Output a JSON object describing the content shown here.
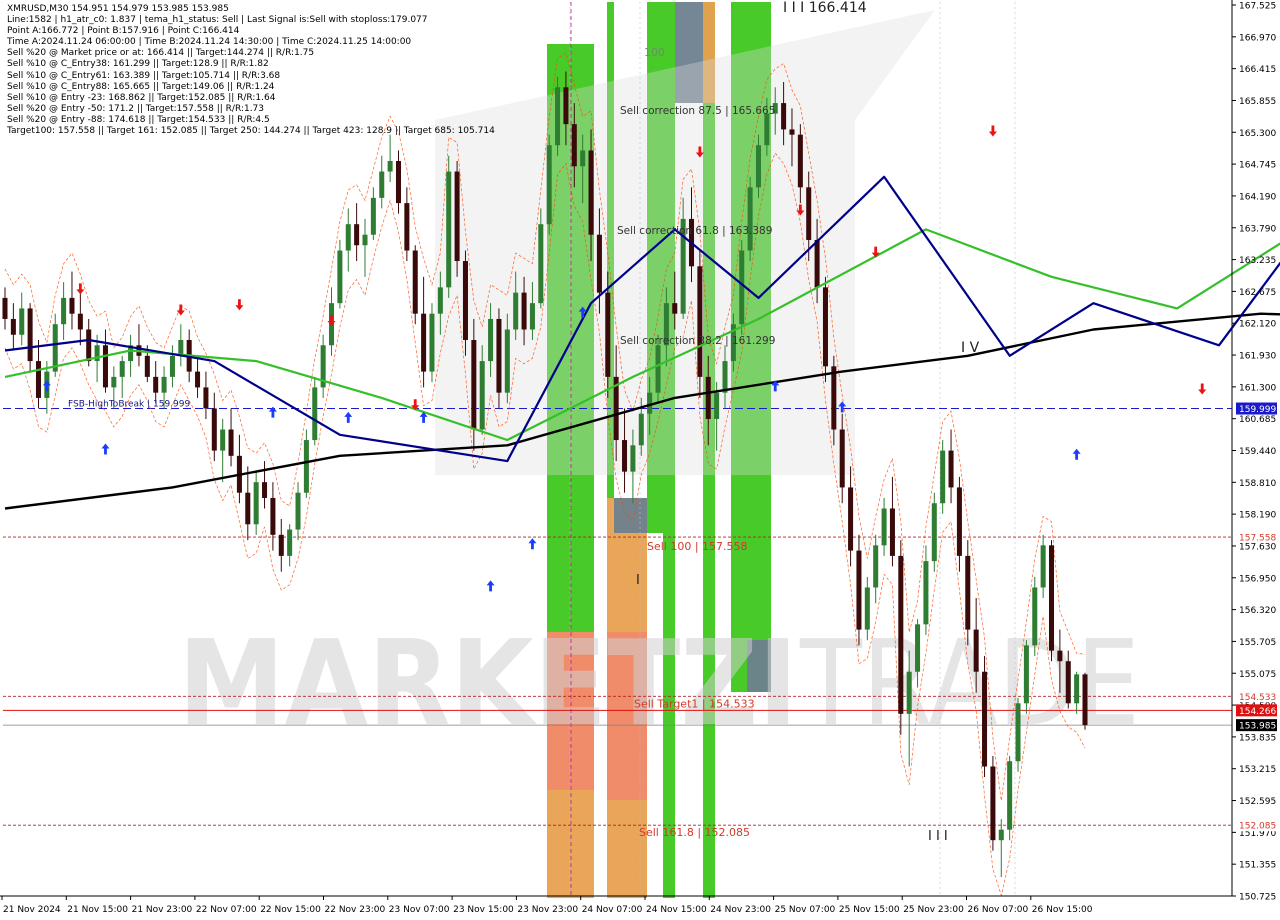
{
  "info": {
    "lines": [
      "XMRUSD,M30  154.951 154.979 153.985 153.985",
      "Line:1582 | h1_atr_c0: 1.837 | tema_h1_status: Sell | Last Signal is:Sell with stoploss:179.077",
      "Point A:166.772 | Point B:157.916 | Point C:166.414",
      "Time A:2024.11.24 06:00:00 | Time B:2024.11.24 14:30:00 | Time C:2024.11.25 14:00:00",
      "Sell %20 @ Market price or at: 166.414 || Target:144.274 || R/R:1.75",
      "Sell %10 @ C_Entry38: 161.299 || Target:128.9 || R/R:1.82",
      "Sell %10 @ C_Entry61: 163.389 || Target:105.714 || R/R:3.68",
      "Sell %10 @ C_Entry88: 165.665 || Target:149.06 || R/R:1.24",
      "Sell %10 @ Entry -23: 168.862 || Target:152.085 || R/R:1.64",
      "Sell %20 @ Entry -50: 171.2 || Target:157.558 || R/R:1.73",
      "Sell %20 @ Entry -88: 174.618 || Target:154.533 || R/R:4.5",
      "Target100: 157.558 || Target 161: 152.085 || Target 250: 144.274 || Target 423: 128.9 || Target 685: 105.714"
    ]
  },
  "watermark": {
    "text_left": "MARKETZI",
    "text_right": "TRADE"
  },
  "colors": {
    "green_zone": "#3ec81e",
    "orange_zone": "#e8a04f",
    "salmon_zone": "#f08a6c",
    "gray_zone": "#6e7f8f",
    "bull_candle": "#2e7d32",
    "bear_candle": "#3a0a0a",
    "ma_slow": "#000000",
    "ma_mid": "#35c02a",
    "ma_fast": "#00008b",
    "envelope": "#ff4500",
    "level_line": "#b22222",
    "blue_dash": "#1a1acd",
    "current_line": "#7f7f7f",
    "arrow_up": "#1a3cff",
    "arrow_down": "#ee1111",
    "trend_red": "#ff0000"
  },
  "chart_data": {
    "type": "candlestick",
    "symbol": "XMRUSD",
    "timeframe": "M30",
    "ylim": [
      150.74,
      167.72
    ],
    "y_ticks": [
      "167.525",
      "166.970",
      "166.415",
      "165.855",
      "165.300",
      "164.745",
      "164.190",
      "163.790",
      "163.235",
      "162.675",
      "162.120",
      "161.930",
      "161.300",
      "160.685",
      "159.440",
      "158.810",
      "158.190",
      "157.630",
      "156.950",
      "156.320",
      "155.705",
      "155.075",
      "154.500",
      "153.835",
      "153.215",
      "152.595",
      "151.970",
      "151.355",
      "150.725"
    ],
    "x_ticks": [
      "21 Nov 2024",
      "21 Nov 15:00",
      "21 Nov 23:00",
      "22 Nov 07:00",
      "22 Nov 15:00",
      "22 Nov 23:00",
      "23 Nov 07:00",
      "23 Nov 15:00",
      "23 Nov 23:00",
      "24 Nov 07:00",
      "24 Nov 15:00",
      "24 Nov 23:00",
      "25 Nov 07:00",
      "25 Nov 15:00",
      "25 Nov 23:00",
      "26 Nov 07:00",
      "26 Nov 15:00"
    ],
    "levels": [
      {
        "label": "Sell 100 | 157.558",
        "price": 157.558,
        "tag": "157.558"
      },
      {
        "label": "Sell Target1 | 154.533",
        "price": 154.533,
        "tag": "154.533"
      },
      {
        "label": "Sell 161.8 | 152.085",
        "price": 152.085,
        "tag": "152.085"
      }
    ],
    "stoploss_line": {
      "price": 154.266,
      "tag": "154.266"
    },
    "fsb_line": {
      "price": 159.999,
      "tag": "159.999",
      "label": "FSB-HighToBreak | 159.999"
    },
    "current_price": {
      "price": 153.985,
      "tag": "153.985"
    },
    "corrections": [
      {
        "label": "Sell correction 87.5 | 165.665",
        "price": 165.665
      },
      {
        "label": "Sell correction 61.8 | 163.389",
        "price": 163.389
      },
      {
        "label": "Sell correction 38.2 | 161.299",
        "price": 161.299
      }
    ],
    "text_marks": {
      "peak_label": "I I I 166.414",
      "wave_iv": "I V",
      "wave_iii": "I I I",
      "wave_i": "I",
      "hundred": "100"
    },
    "candles": [
      [
        162.1,
        162.3,
        161.5,
        161.7
      ],
      [
        161.7,
        162.0,
        161.1,
        161.4
      ],
      [
        161.4,
        162.2,
        161.2,
        161.9
      ],
      [
        161.9,
        162.0,
        160.7,
        160.9
      ],
      [
        160.9,
        161.3,
        160.0,
        160.2
      ],
      [
        160.2,
        160.9,
        159.9,
        160.7
      ],
      [
        160.7,
        161.8,
        160.6,
        161.6
      ],
      [
        161.6,
        162.4,
        161.3,
        162.1
      ],
      [
        162.1,
        162.6,
        161.5,
        161.8
      ],
      [
        161.8,
        162.2,
        161.2,
        161.5
      ],
      [
        161.5,
        161.7,
        160.8,
        160.9
      ],
      [
        160.9,
        161.4,
        160.5,
        161.2
      ],
      [
        161.2,
        161.5,
        160.3,
        160.4
      ],
      [
        160.4,
        160.8,
        160.0,
        160.6
      ],
      [
        160.6,
        161.0,
        160.2,
        160.9
      ],
      [
        160.9,
        161.4,
        160.6,
        161.2
      ],
      [
        161.2,
        161.6,
        160.8,
        161.0
      ],
      [
        161.0,
        161.2,
        160.5,
        160.6
      ],
      [
        160.6,
        160.9,
        160.1,
        160.3
      ],
      [
        160.3,
        160.8,
        160.0,
        160.6
      ],
      [
        160.6,
        161.2,
        160.4,
        161.0
      ],
      [
        161.0,
        161.6,
        160.8,
        161.3
      ],
      [
        161.3,
        161.5,
        160.5,
        160.7
      ],
      [
        160.7,
        161.0,
        160.2,
        160.4
      ],
      [
        160.4,
        160.7,
        159.8,
        160.0
      ],
      [
        160.0,
        160.3,
        159.0,
        159.2
      ],
      [
        159.2,
        159.8,
        158.6,
        159.6
      ],
      [
        159.6,
        160.0,
        158.9,
        159.1
      ],
      [
        159.1,
        159.5,
        158.2,
        158.4
      ],
      [
        158.4,
        158.9,
        157.5,
        157.8
      ],
      [
        157.8,
        158.8,
        157.6,
        158.6
      ],
      [
        158.6,
        159.0,
        158.1,
        158.3
      ],
      [
        158.3,
        158.6,
        157.3,
        157.6
      ],
      [
        157.6,
        157.9,
        156.9,
        157.2
      ],
      [
        157.2,
        157.8,
        157.0,
        157.7
      ],
      [
        157.7,
        158.6,
        157.5,
        158.4
      ],
      [
        158.4,
        159.6,
        158.3,
        159.4
      ],
      [
        159.4,
        160.6,
        159.3,
        160.4
      ],
      [
        160.4,
        161.4,
        160.2,
        161.2
      ],
      [
        161.2,
        162.3,
        161.0,
        162.0
      ],
      [
        162.0,
        163.2,
        161.9,
        163.0
      ],
      [
        163.0,
        163.8,
        162.6,
        163.5
      ],
      [
        163.5,
        163.9,
        162.8,
        163.1
      ],
      [
        163.1,
        163.6,
        162.5,
        163.3
      ],
      [
        163.3,
        164.2,
        163.2,
        164.0
      ],
      [
        164.0,
        164.8,
        163.8,
        164.5
      ],
      [
        164.5,
        165.2,
        164.3,
        164.7
      ],
      [
        164.7,
        164.9,
        163.7,
        163.9
      ],
      [
        163.9,
        164.2,
        162.8,
        163.0
      ],
      [
        163.0,
        163.1,
        161.6,
        161.8
      ],
      [
        161.8,
        162.5,
        160.4,
        160.7
      ],
      [
        160.7,
        162.0,
        160.5,
        161.8
      ],
      [
        161.8,
        162.6,
        161.4,
        162.3
      ],
      [
        162.3,
        164.8,
        162.1,
        164.5
      ],
      [
        164.5,
        164.7,
        162.5,
        162.8
      ],
      [
        162.8,
        163.0,
        161.0,
        161.3
      ],
      [
        161.3,
        161.7,
        159.2,
        159.6
      ],
      [
        159.6,
        161.2,
        159.5,
        160.9
      ],
      [
        160.9,
        162.0,
        160.6,
        161.7
      ],
      [
        161.7,
        161.9,
        160.0,
        160.3
      ],
      [
        160.3,
        161.8,
        160.1,
        161.5
      ],
      [
        161.5,
        162.6,
        161.3,
        162.2
      ],
      [
        162.2,
        162.5,
        161.2,
        161.5
      ],
      [
        161.5,
        162.4,
        161.3,
        162.0
      ],
      [
        162.0,
        163.8,
        161.9,
        163.5
      ],
      [
        163.5,
        165.2,
        163.3,
        165.0
      ],
      [
        165.0,
        166.3,
        164.8,
        166.1
      ],
      [
        166.1,
        166.4,
        165.0,
        165.4
      ],
      [
        165.4,
        165.8,
        164.2,
        164.6
      ],
      [
        164.6,
        165.2,
        163.9,
        164.9
      ],
      [
        164.9,
        165.3,
        162.8,
        163.3
      ],
      [
        163.3,
        163.8,
        161.8,
        162.2
      ],
      [
        162.2,
        162.6,
        160.2,
        160.6
      ],
      [
        160.6,
        161.2,
        159.0,
        159.4
      ],
      [
        159.4,
        160.0,
        158.4,
        158.8
      ],
      [
        158.8,
        159.6,
        158.2,
        159.3
      ],
      [
        159.3,
        160.2,
        159.1,
        159.9
      ],
      [
        159.9,
        160.6,
        159.5,
        160.3
      ],
      [
        160.3,
        161.4,
        160.1,
        161.2
      ],
      [
        161.2,
        162.3,
        160.8,
        162.0
      ],
      [
        162.0,
        162.6,
        161.5,
        161.8
      ],
      [
        161.8,
        164.0,
        161.7,
        163.6
      ],
      [
        163.6,
        164.2,
        162.4,
        162.7
      ],
      [
        162.7,
        163.0,
        160.2,
        160.6
      ],
      [
        160.6,
        161.0,
        159.3,
        159.8
      ],
      [
        159.8,
        160.5,
        159.2,
        160.3
      ],
      [
        160.3,
        161.2,
        160.0,
        160.9
      ],
      [
        160.9,
        161.8,
        160.7,
        161.6
      ],
      [
        161.6,
        163.2,
        161.4,
        163.0
      ],
      [
        163.0,
        164.4,
        162.8,
        164.2
      ],
      [
        164.2,
        165.2,
        164.0,
        165.0
      ],
      [
        165.0,
        165.9,
        164.8,
        165.6
      ],
      [
        165.6,
        166.1,
        165.2,
        165.8
      ],
      [
        165.8,
        166.2,
        165.0,
        165.3
      ],
      [
        165.3,
        165.7,
        164.6,
        165.2
      ],
      [
        165.2,
        165.4,
        163.9,
        164.2
      ],
      [
        164.2,
        164.5,
        162.8,
        163.2
      ],
      [
        163.2,
        163.6,
        162.0,
        162.3
      ],
      [
        162.3,
        162.5,
        160.5,
        160.8
      ],
      [
        160.8,
        161.0,
        159.3,
        159.6
      ],
      [
        159.6,
        159.9,
        158.2,
        158.5
      ],
      [
        158.5,
        158.9,
        157.0,
        157.3
      ],
      [
        157.3,
        157.6,
        155.5,
        155.8
      ],
      [
        155.8,
        156.8,
        155.6,
        156.6
      ],
      [
        156.6,
        157.6,
        156.3,
        157.4
      ],
      [
        157.4,
        158.3,
        157.2,
        158.1
      ],
      [
        158.1,
        158.7,
        157.0,
        157.2
      ],
      [
        157.2,
        157.5,
        153.8,
        154.2
      ],
      [
        154.2,
        155.4,
        153.2,
        155.0
      ],
      [
        155.0,
        156.0,
        154.7,
        155.9
      ],
      [
        155.9,
        157.4,
        155.7,
        157.1
      ],
      [
        157.1,
        158.4,
        156.9,
        158.2
      ],
      [
        158.2,
        159.4,
        158.0,
        159.2
      ],
      [
        159.2,
        159.6,
        158.2,
        158.5
      ],
      [
        158.5,
        158.7,
        156.9,
        157.2
      ],
      [
        157.2,
        157.5,
        155.5,
        155.8
      ],
      [
        155.8,
        156.4,
        154.6,
        155.0
      ],
      [
        155.0,
        155.3,
        153.0,
        153.2
      ],
      [
        153.2,
        153.4,
        151.6,
        151.8
      ],
      [
        151.8,
        152.2,
        151.1,
        152.0
      ],
      [
        152.0,
        153.4,
        151.8,
        153.3
      ],
      [
        153.3,
        154.5,
        153.1,
        154.4
      ],
      [
        154.4,
        155.6,
        154.2,
        155.5
      ],
      [
        155.5,
        156.8,
        155.3,
        156.6
      ],
      [
        156.6,
        157.6,
        156.4,
        157.4
      ],
      [
        157.4,
        157.5,
        155.2,
        155.4
      ],
      [
        155.4,
        155.8,
        154.6,
        155.2
      ],
      [
        155.2,
        155.4,
        154.3,
        154.4
      ],
      [
        154.4,
        155.0,
        154.2,
        154.95
      ],
      [
        154.95,
        154.98,
        153.9,
        153.985
      ]
    ],
    "ma_slow": [
      [
        0,
        158.1
      ],
      [
        20,
        158.5
      ],
      [
        40,
        159.1
      ],
      [
        60,
        159.3
      ],
      [
        80,
        160.2
      ],
      [
        100,
        160.7
      ],
      [
        115,
        161.0
      ],
      [
        130,
        161.5
      ],
      [
        150,
        161.8
      ],
      [
        170,
        161.7
      ],
      [
        190,
        160.2
      ],
      [
        205,
        159.5
      ]
    ],
    "ma_mid": [
      [
        0,
        160.6
      ],
      [
        15,
        161.1
      ],
      [
        30,
        160.9
      ],
      [
        45,
        160.2
      ],
      [
        60,
        159.4
      ],
      [
        75,
        160.6
      ],
      [
        90,
        161.7
      ],
      [
        110,
        163.4
      ],
      [
        125,
        162.5
      ],
      [
        140,
        161.9
      ],
      [
        155,
        163.4
      ],
      [
        170,
        162.5
      ],
      [
        185,
        160.3
      ],
      [
        205,
        156.7
      ]
    ],
    "ma_fast": [
      [
        0,
        161.1
      ],
      [
        10,
        161.3
      ],
      [
        25,
        160.9
      ],
      [
        40,
        159.5
      ],
      [
        60,
        159.0
      ],
      [
        70,
        162.0
      ],
      [
        80,
        163.4
      ],
      [
        90,
        162.1
      ],
      [
        105,
        164.4
      ],
      [
        120,
        161.0
      ],
      [
        130,
        162.0
      ],
      [
        145,
        161.2
      ],
      [
        160,
        164.4
      ],
      [
        170,
        163.2
      ],
      [
        180,
        160.0
      ],
      [
        190,
        158.2
      ],
      [
        200,
        155.0
      ],
      [
        205,
        154.6
      ]
    ],
    "trend_lines": [
      {
        "from": [
          195,
          151.1
        ],
        "to": [
          205,
          154.0
        ]
      },
      {
        "from": [
          195,
          154.5
        ],
        "to": [
          202,
          157.8
        ]
      }
    ],
    "arrows_up": [
      [
        5,
        160.8
      ],
      [
        12,
        159.6
      ],
      [
        32,
        160.3
      ],
      [
        41,
        160.2
      ],
      [
        50,
        160.2
      ],
      [
        58,
        157.0
      ],
      [
        63,
        157.8
      ],
      [
        69,
        162.2
      ],
      [
        92,
        160.8
      ],
      [
        100,
        160.4
      ],
      [
        128,
        159.5
      ],
      [
        154,
        160.9
      ],
      [
        188,
        155.3
      ],
      [
        204,
        154.6
      ]
    ],
    "arrows_down": [
      [
        9,
        161.9
      ],
      [
        21,
        161.5
      ],
      [
        28,
        161.6
      ],
      [
        39,
        161.3
      ],
      [
        49,
        159.7
      ],
      [
        83,
        164.5
      ],
      [
        95,
        163.4
      ],
      [
        104,
        162.6
      ],
      [
        118,
        164.9
      ],
      [
        143,
        160.0
      ],
      [
        163,
        163.9
      ],
      [
        193,
        157.1
      ]
    ]
  }
}
